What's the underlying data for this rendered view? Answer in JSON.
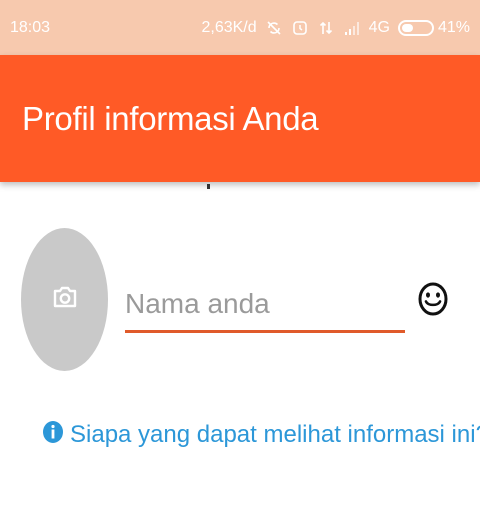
{
  "status_bar": {
    "time": "18:03",
    "net_speed": "2,63K/d",
    "network_type": "4G",
    "battery_percent": "41%",
    "battery_level": 0.41,
    "icons": [
      "no-sync-icon",
      "alarm-icon",
      "data-transfer-icon",
      "signal-icon",
      "battery-icon"
    ]
  },
  "app_bar": {
    "title": "Profil informasi Anda",
    "color": "#ff5a26"
  },
  "profile": {
    "avatar_icon": "camera-icon",
    "name_placeholder": "Nama anda",
    "name_value": "",
    "emoji_icon": "emoji-icon",
    "accent_color": "#e05a2a"
  },
  "info": {
    "icon": "info-icon",
    "link_text": "Siapa yang dapat melihat informasi ini?",
    "color": "#2c97d8"
  }
}
